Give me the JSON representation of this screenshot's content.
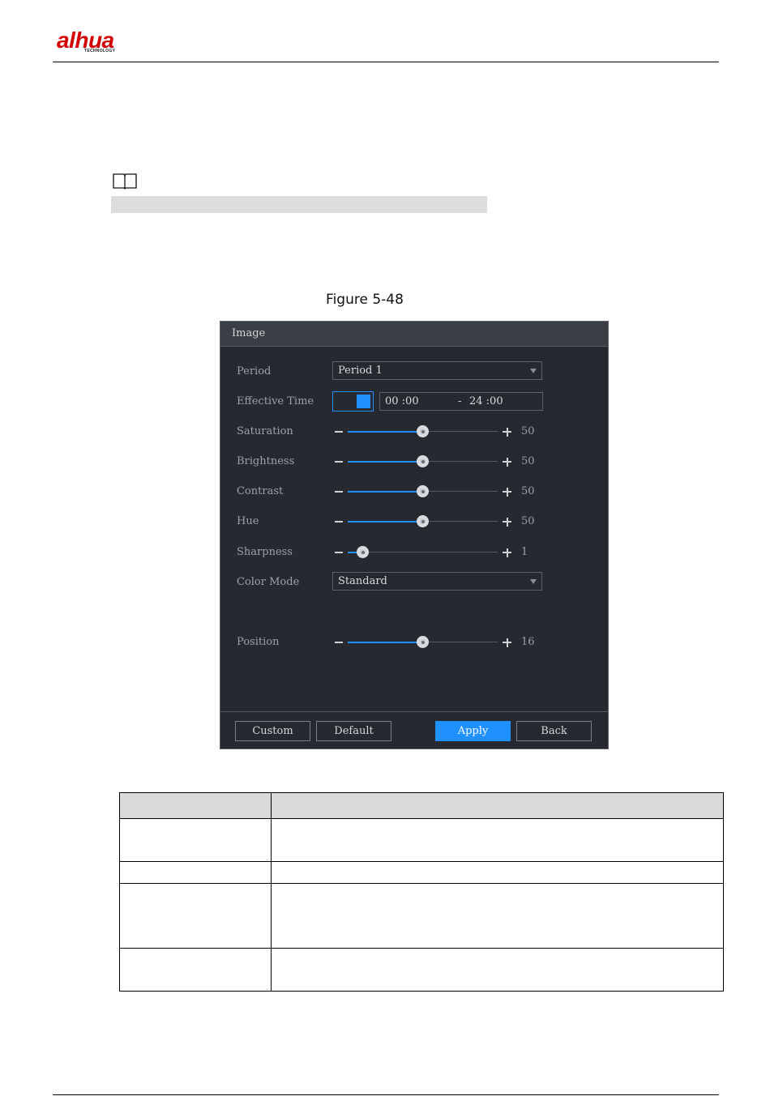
{
  "logo": {
    "wordmark": "alhua",
    "tagline": "TECHNOLOGY"
  },
  "figure": {
    "caption": "Figure 5-48"
  },
  "dialog": {
    "title": "Image",
    "period": {
      "label": "Period",
      "value": "Period 1"
    },
    "effective_time": {
      "label": "Effective Time",
      "toggle_on": true,
      "start": "00 :00",
      "separator": "-",
      "end": "24 :00"
    },
    "sliders": [
      {
        "label": "Saturation",
        "value": "50",
        "level": 0.5
      },
      {
        "label": "Brightness",
        "value": "50",
        "level": 0.5
      },
      {
        "label": "Contrast",
        "value": "50",
        "level": 0.5
      },
      {
        "label": "Hue",
        "value": "50",
        "level": 0.5
      },
      {
        "label": "Sharpness",
        "value": "1",
        "level": 0.1
      }
    ],
    "color_mode": {
      "label": "Color Mode",
      "value": "Standard"
    },
    "position": {
      "label": "Position",
      "value": "16",
      "level": 0.5
    },
    "buttons": {
      "custom": "Custom",
      "default": "Default",
      "apply": "Apply",
      "back": "Back"
    }
  },
  "colors": {
    "accent": "#1e90ff",
    "panel_bg": "#262a30",
    "brand": "#d40000"
  },
  "table": {
    "header": [
      "",
      ""
    ],
    "rows": [
      [
        "",
        ""
      ],
      [
        "",
        ""
      ],
      [
        "",
        ""
      ],
      [
        "",
        ""
      ]
    ]
  }
}
